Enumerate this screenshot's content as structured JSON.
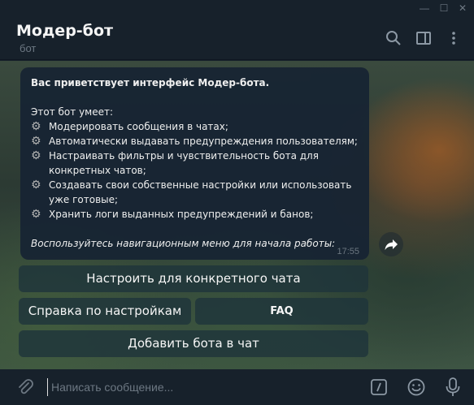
{
  "window": {
    "minimize": "—",
    "maximize": "☐",
    "close": "✕"
  },
  "header": {
    "title": "Модер-бот",
    "subtitle": "бот",
    "icons": [
      "search-icon",
      "sidebar-toggle-icon",
      "more-vertical-icon"
    ]
  },
  "message": {
    "greeting": "Вас приветствует интерфейс Модер-бота.",
    "intro": "Этот бот умеет:",
    "items": [
      "Модерировать сообщения в чатах;",
      "Автоматически выдавать предупреждения пользователям;",
      "Настраивать фильтры и чувствительность бота для конкретных чатов;",
      "Создавать свои собственные настройки или использовать уже готовые;",
      "Хранить логи выданных предупреждений и банов;"
    ],
    "footer": "Воспользуйтесь навигационным меню для начала работы:",
    "time": "17:55"
  },
  "keyboard": {
    "row1": "Настроить для конкретного чата",
    "row2_left": "Справка по настройкам",
    "row2_right": "FAQ",
    "row3": "Добавить бота в чат"
  },
  "composer": {
    "placeholder": "Написать сообщение...",
    "icons": [
      "attach-icon",
      "commands-icon",
      "emoji-icon",
      "microphone-icon"
    ]
  },
  "colors": {
    "background": "#17212b",
    "bubble": "#182533",
    "text": "#f5f5f5",
    "muted": "#6d7883"
  }
}
